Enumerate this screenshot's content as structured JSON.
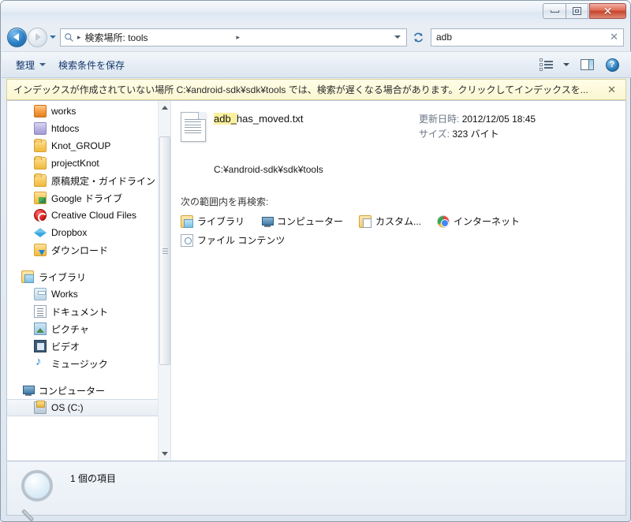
{
  "window": {
    "controls": {
      "minimize": "–",
      "maximize": "□",
      "close": "✕"
    }
  },
  "navbar": {
    "back_title": "戻る",
    "forward_title": "進む",
    "address_icon": "search-icon",
    "address_text": "検索場所: tools",
    "crumb_sep": "▸",
    "refresh_icon": "refresh-icon",
    "search_value": "adb",
    "search_clear": "✕"
  },
  "toolbar": {
    "organize_label": "整理",
    "save_search_label": "検索条件を保存",
    "views_icon": "views-icon",
    "preview_pane_icon": "preview-pane-icon",
    "help_icon": "help-icon",
    "help_glyph": "?"
  },
  "infobar": {
    "text": "インデックスが作成されていない場所 C:¥android-sdk¥sdk¥tools では、検索が遅くなる場合があります。クリックしてインデックスを...",
    "close": "✕",
    "background": "#fffde7"
  },
  "sidebar": {
    "items": [
      {
        "label": "works",
        "icon": "folder-orange-icon",
        "depth": 1,
        "selected": false
      },
      {
        "label": "htdocs",
        "icon": "folder-purple-icon",
        "depth": 1,
        "selected": false
      },
      {
        "label": "Knot_GROUP",
        "icon": "folder-icon",
        "depth": 1,
        "selected": false
      },
      {
        "label": "projectKnot",
        "icon": "folder-icon",
        "depth": 1,
        "selected": false
      },
      {
        "label": "原稿規定・ガイドライン",
        "icon": "folder-icon",
        "depth": 1,
        "selected": false
      },
      {
        "label": "Google ドライブ",
        "icon": "folder-gdrive-icon",
        "depth": 1,
        "selected": false
      },
      {
        "label": "Creative Cloud Files",
        "icon": "creative-cloud-icon",
        "depth": 1,
        "selected": false
      },
      {
        "label": "Dropbox",
        "icon": "dropbox-icon",
        "depth": 1,
        "selected": false
      },
      {
        "label": "ダウンロード",
        "icon": "folder-download-icon",
        "depth": 1,
        "selected": false
      }
    ],
    "library_group": {
      "label": "ライブラリ",
      "icon": "library-icon",
      "items": [
        {
          "label": "Works",
          "icon": "works-library-icon"
        },
        {
          "label": "ドキュメント",
          "icon": "documents-icon"
        },
        {
          "label": "ピクチャ",
          "icon": "pictures-icon"
        },
        {
          "label": "ビデオ",
          "icon": "videos-icon"
        },
        {
          "label": "ミュージック",
          "icon": "music-icon"
        }
      ]
    },
    "computer_group": {
      "label": "コンピューター",
      "icon": "computer-icon",
      "items": [
        {
          "label": "OS (C:)",
          "icon": "drive-icon",
          "selected": true
        }
      ]
    },
    "scrollbar": {
      "up": "▲",
      "down": "▼"
    }
  },
  "results": {
    "file": {
      "icon": "text-file-icon",
      "name_highlight": "adb_",
      "name_rest": "has_moved.txt",
      "modified_label": "更新日時:",
      "modified_value": "2012/12/05 18:45",
      "size_label": "サイズ:",
      "size_value": "323 バイト",
      "path": "C:¥android-sdk¥sdk¥tools",
      "highlight_color": "#faf0a0"
    },
    "search_again": {
      "title": "次の範囲内を再検索:",
      "links": [
        {
          "label": "ライブラリ",
          "icon": "library-icon"
        },
        {
          "label": "コンピューター",
          "icon": "computer-icon"
        },
        {
          "label": "カスタム...",
          "icon": "custom-folder-icon"
        },
        {
          "label": "インターネット",
          "icon": "chrome-icon"
        },
        {
          "label": "ファイル コンテンツ",
          "icon": "file-content-icon"
        }
      ]
    }
  },
  "statusbar": {
    "icon": "magnifier-icon",
    "text": "1 個の項目"
  }
}
